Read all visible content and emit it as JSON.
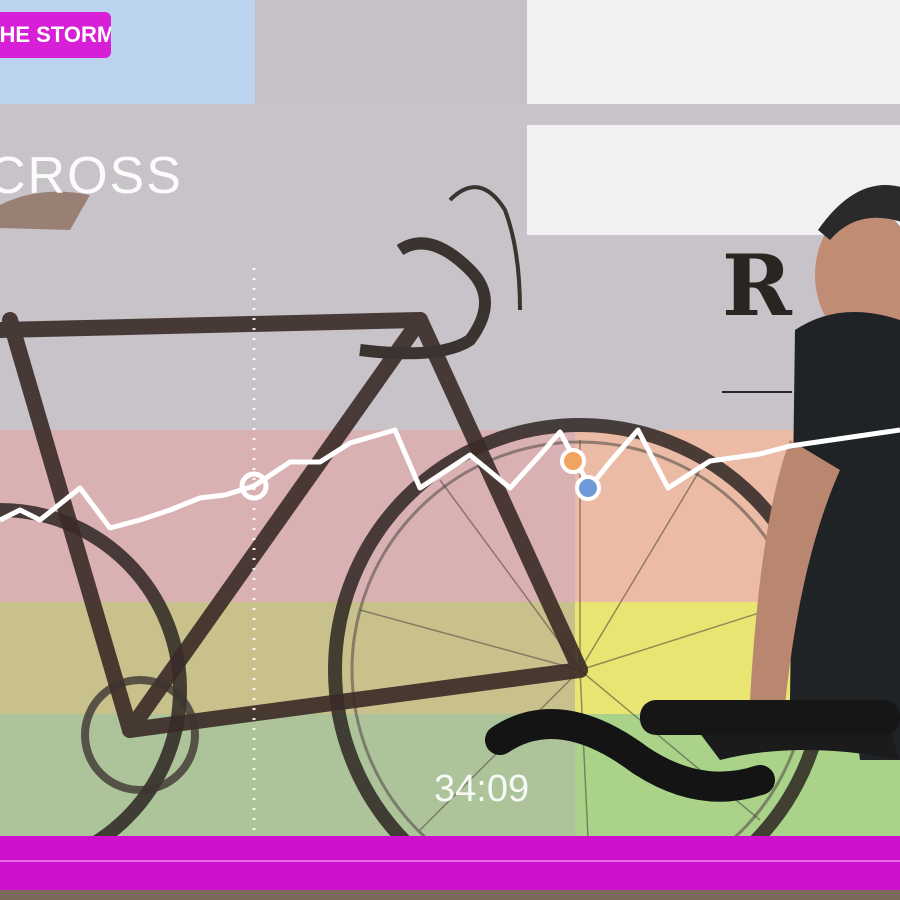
{
  "header": {
    "workout_badge": "THE STORM"
  },
  "screen_text": {
    "cross_title": "CROSS",
    "partial_letter": "R"
  },
  "timer": {
    "elapsed": "34:09"
  },
  "colors": {
    "badge": "#d61fd6",
    "progress_bar": "#cc10cc",
    "zone_red": "#e89a9a",
    "zone_orange": "#f3b98a",
    "zone_yellow": "#f2ee66",
    "zone_green": "#8fcf63",
    "graph_line": "#ffffff"
  },
  "icons": [
    "position-marker-icon",
    "checkpoint-marker-icon"
  ]
}
